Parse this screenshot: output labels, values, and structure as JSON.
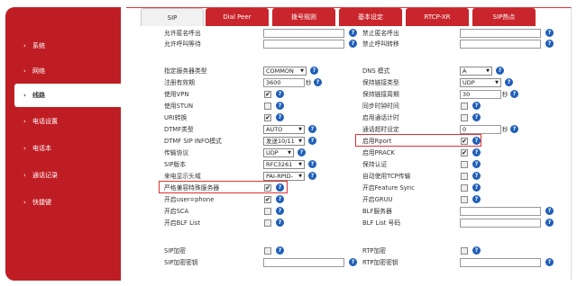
{
  "sidebar": {
    "items": [
      {
        "label": "系统"
      },
      {
        "label": "网络"
      },
      {
        "label": "线路"
      },
      {
        "label": "电话设置"
      },
      {
        "label": "电话本"
      },
      {
        "label": "通话记录"
      },
      {
        "label": "快捷键"
      }
    ],
    "arrow": "›"
  },
  "tabs": [
    {
      "label": "SIP"
    },
    {
      "label": "Dial Peer"
    },
    {
      "label": "拨号规则"
    },
    {
      "label": "基本设定"
    },
    {
      "label": "RTCP-XR"
    },
    {
      "label": "SIP热点"
    }
  ],
  "left_fields": {
    "allow_anon_in": {
      "label": "允许匿名呼出"
    },
    "allow_call_waiting": {
      "label": "允许呼叫等待"
    },
    "server_type": {
      "label": "指定服务器类型",
      "value": "COMMON"
    },
    "reg_expire": {
      "label": "注册有效期",
      "value": "3600",
      "unit": "秒"
    },
    "use_vpn": {
      "label": "使用VPN"
    },
    "use_stun": {
      "label": "使用STUN"
    },
    "uri_convert": {
      "label": "URI转换"
    },
    "dtmf_type": {
      "label": "DTMF类型",
      "value": "AUTO"
    },
    "dtmf_sip_info": {
      "label": "DTMF SIP INFO模式",
      "value": "发送10/11"
    },
    "transport": {
      "label": "传输协议",
      "value": "UDP"
    },
    "sip_version": {
      "label": "SIP版本",
      "value": "RFC3261"
    },
    "caller_id_header": {
      "label": "来电显示头域",
      "value": "PAI-RPID-"
    },
    "strict_proxy": {
      "label": "严格兼容特殊服务器"
    },
    "enable_user_phone": {
      "label": "开启user=phone"
    },
    "enable_sca": {
      "label": "开启SCA"
    },
    "enable_blf_list": {
      "label": "开启BLF List"
    },
    "sip_encrypt": {
      "label": "SIP加密"
    },
    "sip_encrypt_key": {
      "label": "SIP加密密钥"
    }
  },
  "right_fields": {
    "block_anon_out": {
      "label": "禁止匿名呼出"
    },
    "block_forward": {
      "label": "禁止呼叫转移"
    },
    "dns_mode": {
      "label": "DNS 模式",
      "value": "A"
    },
    "keepalive_type": {
      "label": "保持链接类型",
      "value": "UDP"
    },
    "keepalive_interval": {
      "label": "保持链接周期",
      "value": "30",
      "unit": "秒"
    },
    "sync_clock": {
      "label": "同步时钟时间"
    },
    "enable_session_timer": {
      "label": "启用通话计时"
    },
    "session_timeout": {
      "label": "通话超时设定",
      "value": "0",
      "unit": "秒"
    },
    "enable_rport": {
      "label": "启用Rport"
    },
    "enable_prack": {
      "label": "启用PRACK"
    },
    "keep_auth": {
      "label": "保持认证"
    },
    "auto_tcp": {
      "label": "自动使用TCP传输"
    },
    "feature_sync": {
      "label": "开启Feature Sync"
    },
    "enable_gruu": {
      "label": "开启GRUU"
    },
    "blf_server": {
      "label": "BLF服务器"
    },
    "blf_list_num": {
      "label": "BLF List 号码"
    },
    "rtp_encrypt": {
      "label": "RTP加密"
    },
    "rtp_encrypt_key": {
      "label": "RTP加密密钥"
    }
  },
  "help_glyph": "?",
  "check_glyph": "✔",
  "caret_glyph": "▼",
  "colors": {
    "brand_red": "#c9252c",
    "help_blue": "#1f5fb8",
    "highlight": "#e03030"
  }
}
